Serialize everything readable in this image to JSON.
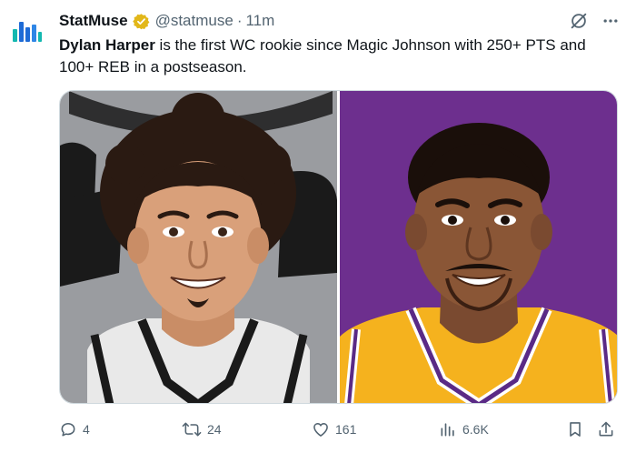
{
  "tweet": {
    "author_name": "StatMuse",
    "handle": "@statmuse",
    "separator": "·",
    "time": "11m",
    "text_bold": "Dylan Harper",
    "text_rest": " is the first WC rookie since Magic Johnson with 250+ PTS and 100+ REB in a postseason."
  },
  "icons": {
    "avatar": "statmuse-logo",
    "badge": "verified-badge",
    "grok": "grok-icon",
    "more": "more-icon",
    "reply": "reply-icon",
    "retweet": "retweet-icon",
    "like": "like-icon",
    "views": "views-icon",
    "bookmark": "bookmark-icon",
    "share": "share-icon"
  },
  "colors": {
    "badge_gold": "#e2b719",
    "logo_blue": "#1e6bd6",
    "logo_teal": "#14b8b0",
    "left_bg": "#9a9ca0",
    "right_bg": "#6d2f8e",
    "muted": "#536471"
  },
  "stats": {
    "replies": "4",
    "retweets": "24",
    "likes": "161",
    "views": "6.6K"
  }
}
